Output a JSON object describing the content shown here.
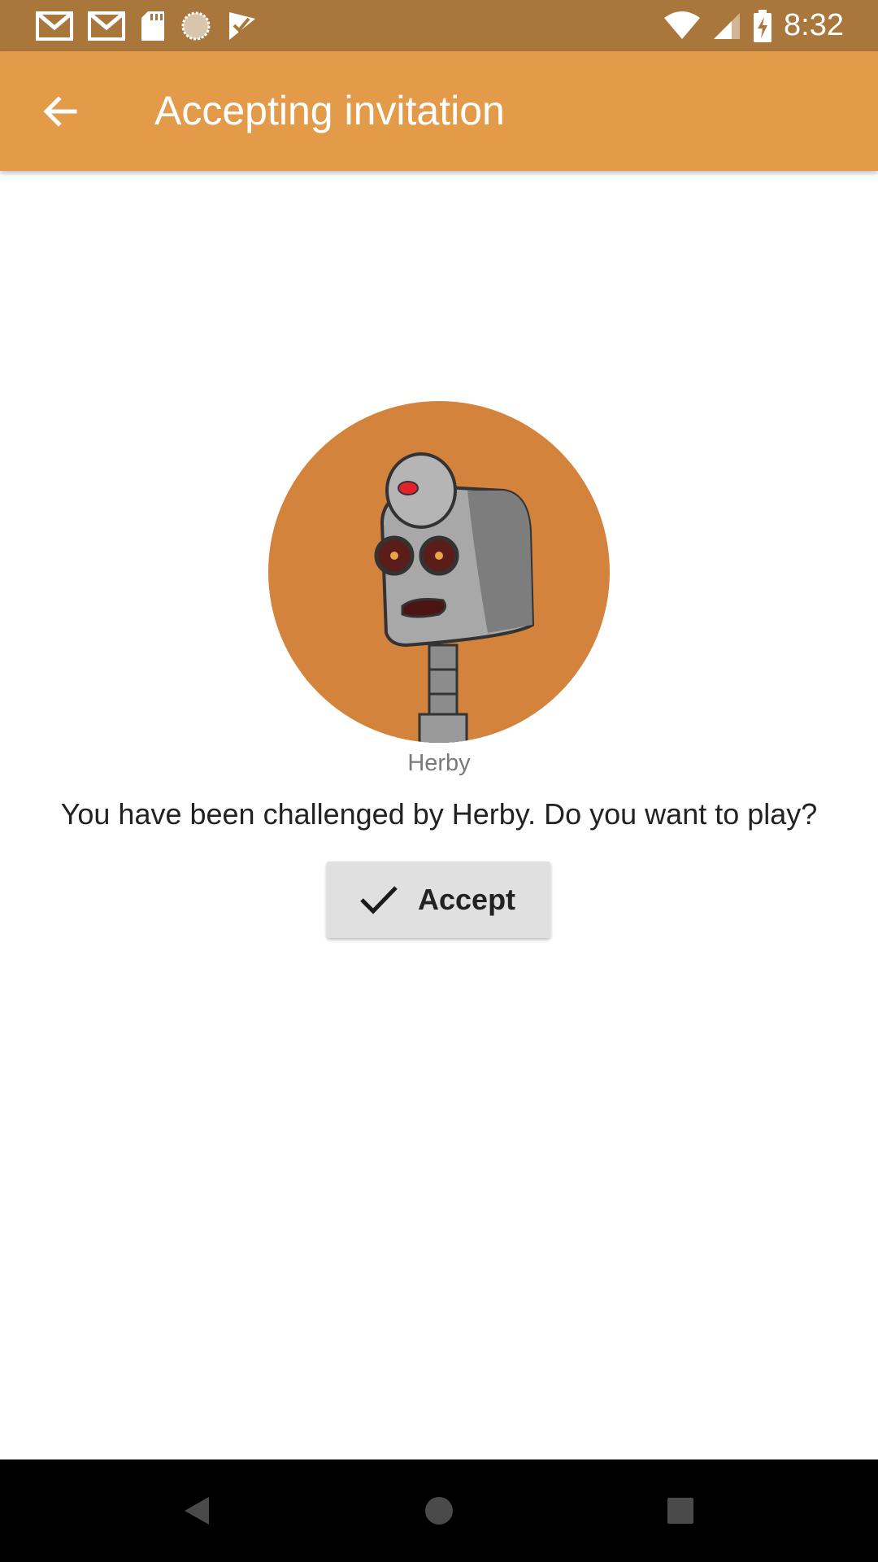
{
  "status_bar": {
    "time": "8:32",
    "icons_left": [
      "gmail-icon",
      "gmail-icon",
      "sd-card-icon",
      "sync-icon",
      "checkmark-flag-icon"
    ],
    "icons_right": [
      "wifi-icon",
      "signal-icon",
      "battery-charging-icon"
    ]
  },
  "app_bar": {
    "title": "Accepting invitation",
    "back_icon": "arrow-back-icon"
  },
  "challenge": {
    "player_name": "Herby",
    "message": "You have been challenged by Herby. Do you want to play?",
    "accept_label": "Accept",
    "accept_icon": "check-icon"
  },
  "nav_bar": {
    "buttons": [
      "back",
      "home",
      "recents"
    ]
  },
  "colors": {
    "status_bar": "#a9773b",
    "app_bar": "#e39b4a",
    "avatar_bg": "#d4833d",
    "button_bg": "#e0e0e0"
  }
}
